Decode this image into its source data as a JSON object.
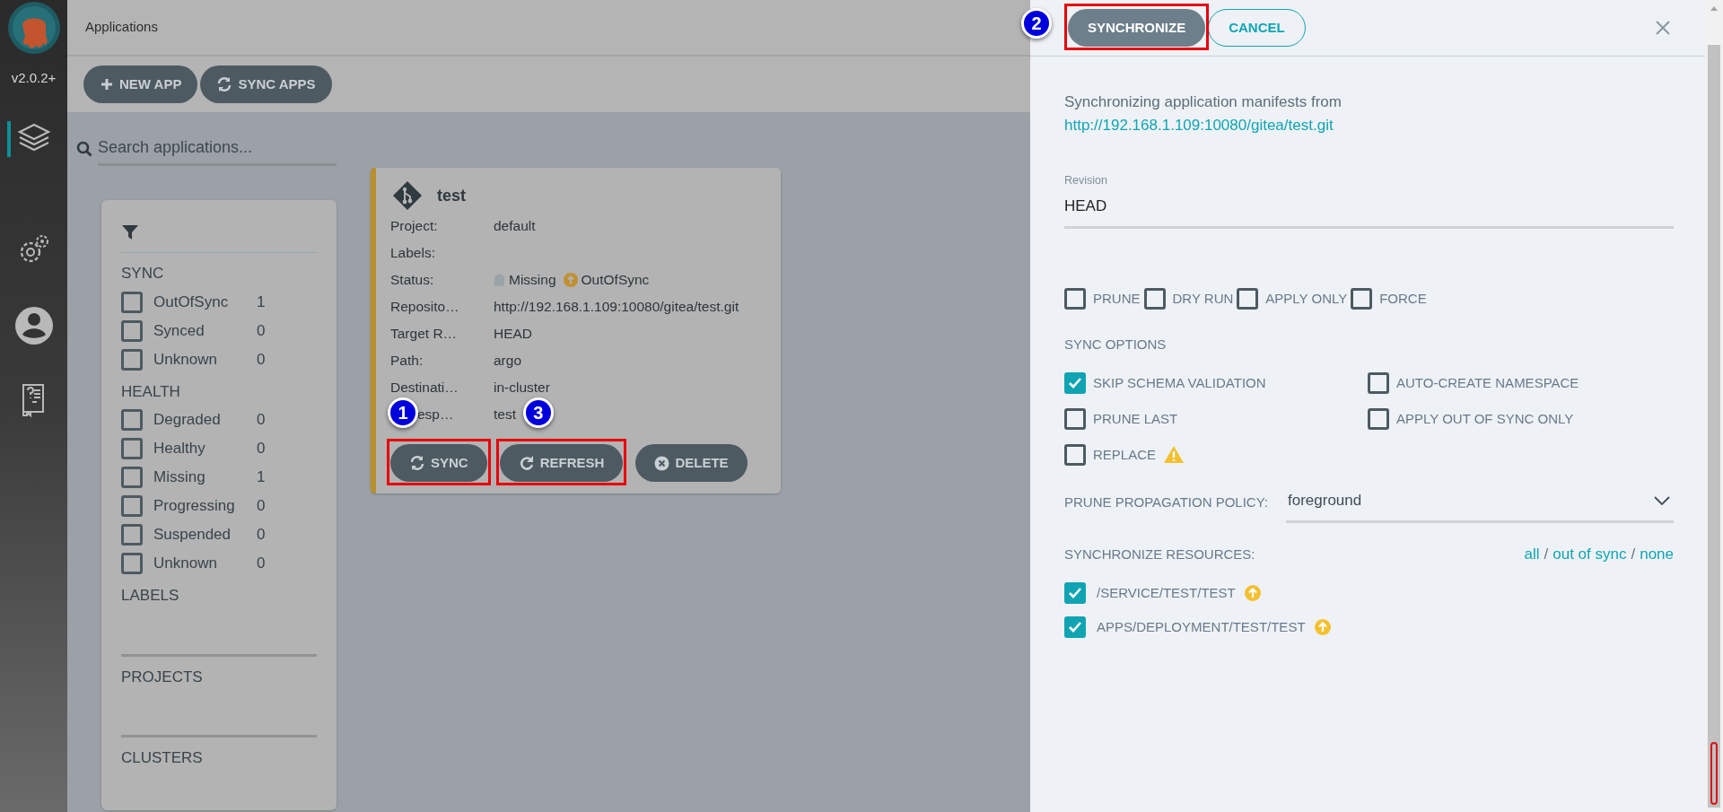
{
  "sidebar": {
    "version": "v2.0.2+",
    "items": [
      {
        "kind": "apps",
        "selected": true
      },
      {
        "kind": "settings",
        "selected": false
      },
      {
        "kind": "user",
        "selected": false
      },
      {
        "kind": "docs",
        "selected": false
      }
    ]
  },
  "header": {
    "title": "Applications"
  },
  "toolbar": {
    "buttons": [
      {
        "kind": "plus",
        "label": "NEW APP"
      },
      {
        "kind": "sync",
        "label": "SYNC APPS"
      }
    ]
  },
  "search": {
    "placeholder": "Search applications..."
  },
  "filters": {
    "sections": [
      {
        "title": "SYNC",
        "items": [
          {
            "label": "OutOfSync",
            "count": "1",
            "checked": false
          },
          {
            "label": "Synced",
            "count": "0",
            "checked": false
          },
          {
            "label": "Unknown",
            "count": "0",
            "checked": false
          }
        ]
      },
      {
        "title": "HEALTH",
        "items": [
          {
            "label": "Degraded",
            "count": "0",
            "checked": false
          },
          {
            "label": "Healthy",
            "count": "0",
            "checked": false
          },
          {
            "label": "Missing",
            "count": "1",
            "checked": false
          },
          {
            "label": "Progressing",
            "count": "0",
            "checked": false
          },
          {
            "label": "Suspended",
            "count": "0",
            "checked": false
          },
          {
            "label": "Unknown",
            "count": "0",
            "checked": false
          }
        ]
      },
      {
        "title": "LABELS"
      },
      {
        "title": "PROJECTS"
      },
      {
        "title": "CLUSTERS"
      }
    ]
  },
  "app_card": {
    "name": "test",
    "fields": [
      {
        "label": "Project:",
        "value": "default"
      },
      {
        "label": "Labels:"
      },
      {
        "label": "Status:",
        "kind": "status",
        "health": "Missing",
        "sync": "OutOfSync"
      },
      {
        "label": "Reposito…",
        "value": "http://192.168.1.109:10080/gitea/test.git"
      },
      {
        "label": "Target R…",
        "value": "HEAD"
      },
      {
        "label": "Path:",
        "value": "argo"
      },
      {
        "label": "Destinati…",
        "value": "in-cluster"
      },
      {
        "label": "esp…",
        "value": "test",
        "obscured": true
      }
    ],
    "buttons": [
      {
        "kind": "sync",
        "label": "SYNC",
        "highlighted": true,
        "marker": "1"
      },
      {
        "kind": "refresh",
        "label": "REFRESH",
        "highlighted": true,
        "marker": "3"
      },
      {
        "kind": "delete",
        "label": "DELETE",
        "highlighted": false
      }
    ]
  },
  "sync_panel": {
    "buttons": [
      {
        "kind": "primary",
        "label": "SYNCHRONIZE",
        "highlighted": true,
        "marker": "2"
      },
      {
        "kind": "outline",
        "label": "CANCEL",
        "highlighted": false
      }
    ],
    "intro": "Synchronizing application manifests from",
    "repo_url": "http://192.168.1.109:10080/gitea/test.git",
    "revision": {
      "label": "Revision",
      "value": "HEAD"
    },
    "options": [
      {
        "label": "PRUNE",
        "checked": false
      },
      {
        "label": "DRY RUN",
        "checked": false
      },
      {
        "label": "APPLY ONLY",
        "checked": false
      },
      {
        "label": "FORCE",
        "checked": false
      }
    ],
    "sync_options_title": "SYNC OPTIONS",
    "sync_options": [
      {
        "label": "SKIP SCHEMA VALIDATION",
        "checked": true
      },
      {
        "label": "AUTO-CREATE NAMESPACE",
        "checked": false
      },
      {
        "label": "PRUNE LAST",
        "checked": false
      },
      {
        "label": "APPLY OUT OF SYNC ONLY",
        "checked": false
      },
      {
        "label": "REPLACE",
        "checked": false,
        "warning": true
      }
    ],
    "prune_policy": {
      "label": "PRUNE PROPAGATION POLICY:",
      "value": "foreground"
    },
    "resources_title": "SYNCHRONIZE RESOURCES:",
    "selectors": [
      {
        "kind": "link",
        "text": "all"
      },
      {
        "kind": "separator",
        "text": "/"
      },
      {
        "kind": "link",
        "text": "out of sync"
      },
      {
        "kind": "separator",
        "text": "/"
      },
      {
        "kind": "link",
        "text": "none"
      }
    ],
    "resources": [
      {
        "name": "/SERVICE/TEST/TEST",
        "checked": true,
        "out_of_sync": true
      },
      {
        "name": "APPS/DEPLOYMENT/TEST/TEST",
        "checked": true,
        "out_of_sync": true
      }
    ]
  }
}
